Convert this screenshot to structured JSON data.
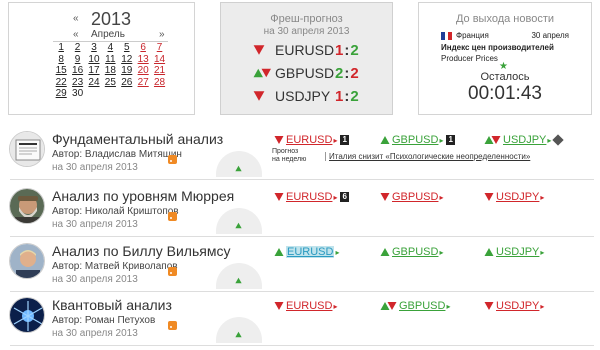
{
  "calendar": {
    "year": "2013",
    "month": "Апрель",
    "prev": "«",
    "next": "»",
    "weeks": [
      [
        "1",
        "2",
        "3",
        "4",
        "5",
        "6",
        "7"
      ],
      [
        "8",
        "9",
        "10",
        "11",
        "12",
        "13",
        "14"
      ],
      [
        "15",
        "16",
        "17",
        "18",
        "19",
        "20",
        "21"
      ],
      [
        "22",
        "23",
        "24",
        "25",
        "26",
        "27",
        "28"
      ],
      [
        "29",
        "30",
        "",
        "",
        "",
        "",
        ""
      ]
    ]
  },
  "fresh": {
    "title": "Фреш-прогноз",
    "date": "на 30 апреля 2013",
    "items": [
      {
        "pair": "EURUSD",
        "score": "1:2",
        "trend": "down"
      },
      {
        "pair": "GBPUSD",
        "score": "2:2",
        "trend": "both"
      },
      {
        "pair": "USDJPY",
        "score": "1:2",
        "trend": "down"
      }
    ]
  },
  "news": {
    "title": "До выхода новости",
    "country": "Франция",
    "date": "30 апреля",
    "name": "Индекс цен производителей",
    "subname": "Producer Prices",
    "star": "★",
    "left_label": "Осталось",
    "timer": "00:01:43",
    "flag_colors": [
      "#1f3f99",
      "#ffffff",
      "#d1262b"
    ]
  },
  "colors": {
    "up": "#3aa23a",
    "down": "#d1262b",
    "accent_rss": "#f08a24"
  },
  "rows": [
    {
      "title": "Фундаментальный анализ",
      "author": "Автор: Владислав Митяшин",
      "date": "на 30 апреля 2013",
      "avatar": "newspaper-avatar",
      "forecast_label": [
        "Прогноз",
        "на неделю"
      ],
      "forecast_link": "Италия снизит «Психологические неопределенности»",
      "signals": [
        {
          "pair": "EURUSD",
          "trend": "down",
          "badge": "1"
        },
        {
          "pair": "GBPUSD",
          "trend": "up",
          "badge": "1"
        },
        {
          "pair": "USDJPY",
          "trend": "both",
          "badge": "diamond"
        }
      ]
    },
    {
      "title": "Анализ по уровням Мюррея",
      "author": "Автор: Николай Криштопов",
      "date": "на 30 апреля 2013",
      "avatar": "bearded-man-avatar",
      "signals": [
        {
          "pair": "EURUSD",
          "trend": "down",
          "badge": "6"
        },
        {
          "pair": "GBPUSD",
          "trend": "down",
          "badge": ""
        },
        {
          "pair": "USDJPY",
          "trend": "down",
          "badge": ""
        }
      ]
    },
    {
      "title": "Анализ по Биллу Вильямсу",
      "author": "Автор: Матвей Криволапов",
      "date": "на 30 апреля 2013",
      "avatar": "man-portrait-avatar",
      "signals": [
        {
          "pair": "EURUSD",
          "trend": "up",
          "badge": "",
          "highlight": true
        },
        {
          "pair": "GBPUSD",
          "trend": "up",
          "badge": ""
        },
        {
          "pair": "USDJPY",
          "trend": "up",
          "badge": ""
        }
      ]
    },
    {
      "title": "Квантовый анализ",
      "author": "Автор: Роман Петухов",
      "date": "на 30 апреля 2013",
      "avatar": "quantum-avatar",
      "signals": [
        {
          "pair": "EURUSD",
          "trend": "down",
          "badge": ""
        },
        {
          "pair": "GBPUSD",
          "trend": "both",
          "badge": ""
        },
        {
          "pair": "USDJPY",
          "trend": "down",
          "badge": ""
        }
      ]
    }
  ]
}
